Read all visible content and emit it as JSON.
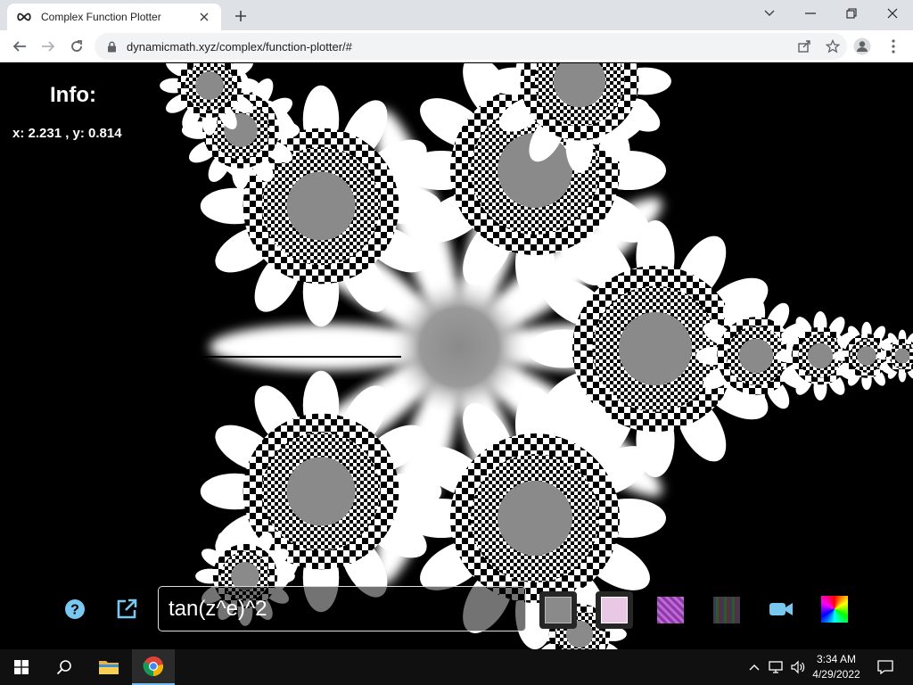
{
  "browser": {
    "tab": {
      "title": "Complex Function Plotter",
      "favicon": "infinity-icon"
    },
    "url": "dynamicmath.xyz/complex/function-plotter/#",
    "icons": [
      "back-icon",
      "forward-icon",
      "reload-icon",
      "lock-icon",
      "share-icon",
      "star-icon",
      "profile-icon",
      "menu-icon"
    ]
  },
  "page": {
    "info": {
      "title": "Info:",
      "coords": "x: 2.231 , y: 0.814"
    },
    "function_input": {
      "value": "tan(z^e)^2"
    },
    "controls": {
      "left_icons": [
        "help-icon",
        "open-external-icon"
      ],
      "swatches": [
        {
          "name": "gray-checker",
          "color": "#8a8a8a"
        },
        {
          "name": "pink-checker",
          "color": "#e9c8e6"
        },
        {
          "name": "purple-checker",
          "color": "#8e3aa8"
        },
        {
          "name": "dark-multicolor",
          "color": "#3a3a55"
        }
      ],
      "right_icons": [
        "video-camera-icon",
        "color-wheel-icon"
      ]
    },
    "colors": {
      "accent": "#78c8f0",
      "plot_gray": "#8a8a8a"
    }
  },
  "taskbar": {
    "time": "3:34 AM",
    "date": "4/29/2022",
    "apps": [
      "windows-start-icon",
      "search-icon",
      "file-explorer-icon",
      "chrome-icon"
    ],
    "tray": [
      "chevron-up-icon",
      "network-icon",
      "volume-icon",
      "notification-icon"
    ]
  }
}
